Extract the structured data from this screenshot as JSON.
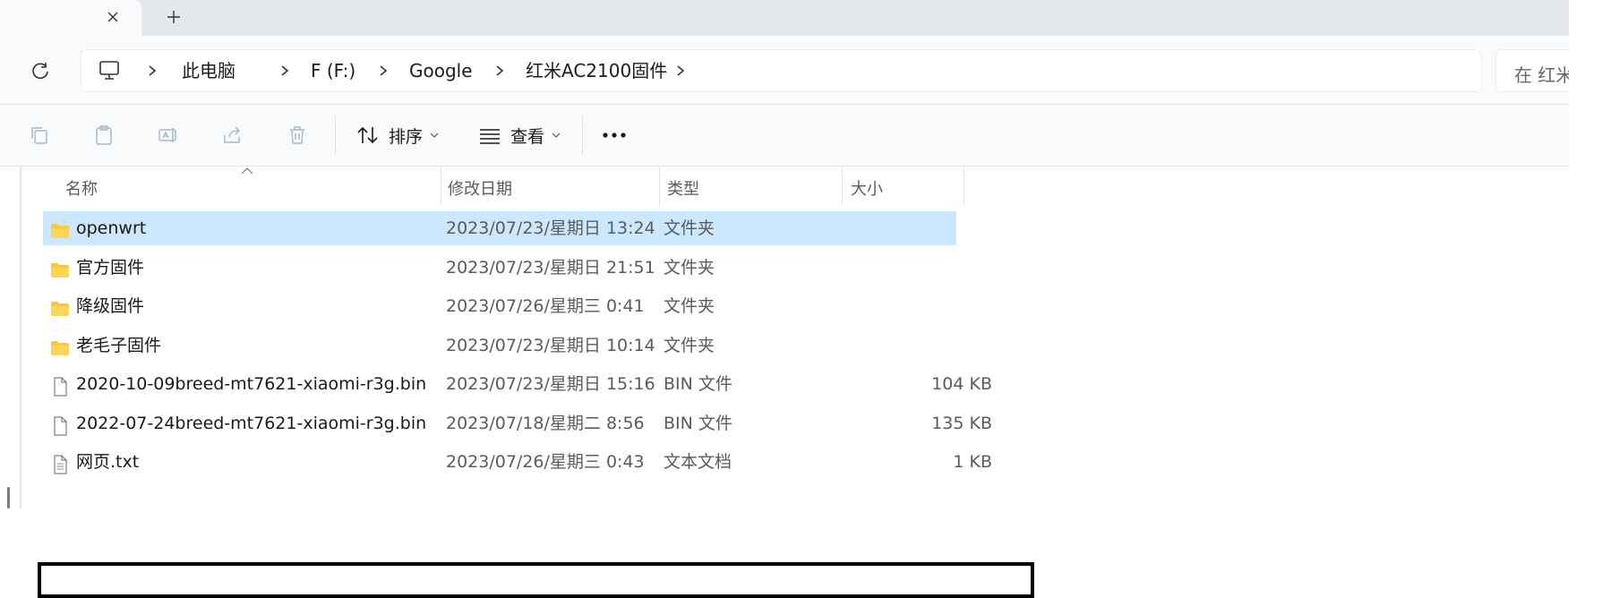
{
  "tabs": {
    "close_glyph": "✕",
    "new_tab_glyph": "+"
  },
  "breadcrumb": {
    "items": [
      "此电脑",
      "F (F:)",
      "Google",
      "红米AC2100固件"
    ]
  },
  "search": {
    "placeholder": "在 红米"
  },
  "toolbar": {
    "sort_label": "排序",
    "view_label": "查看",
    "more_label": "···"
  },
  "columns": {
    "name": "名称",
    "date": "修改日期",
    "type": "类型",
    "size": "大小"
  },
  "files": [
    {
      "name": "openwrt",
      "date": "2023/07/23/星期日 13:24",
      "type": "文件夹",
      "size": "",
      "kind": "folder",
      "selected": true
    },
    {
      "name": "官方固件",
      "date": "2023/07/23/星期日 21:51",
      "type": "文件夹",
      "size": "",
      "kind": "folder",
      "selected": false
    },
    {
      "name": "降级固件",
      "date": "2023/07/26/星期三 0:41",
      "type": "文件夹",
      "size": "",
      "kind": "folder",
      "selected": false
    },
    {
      "name": "老毛子固件",
      "date": "2023/07/23/星期日 10:14",
      "type": "文件夹",
      "size": "",
      "kind": "folder",
      "selected": false
    },
    {
      "name": "2020-10-09breed-mt7621-xiaomi-r3g.bin",
      "date": "2023/07/23/星期日 15:16",
      "type": "BIN 文件",
      "size": "104 KB",
      "kind": "file",
      "selected": false
    },
    {
      "name": "2022-07-24breed-mt7621-xiaomi-r3g.bin",
      "date": "2023/07/18/星期二 8:56",
      "type": "BIN 文件",
      "size": "135 KB",
      "kind": "file",
      "selected": false
    },
    {
      "name": "网页.txt",
      "date": "2023/07/26/星期三 0:43",
      "type": "文本文档",
      "size": "1 KB",
      "kind": "text",
      "selected": false
    }
  ],
  "colors": {
    "selection": "#cce8ff",
    "folder": "#f8c93c",
    "accent": "#005fb8"
  }
}
